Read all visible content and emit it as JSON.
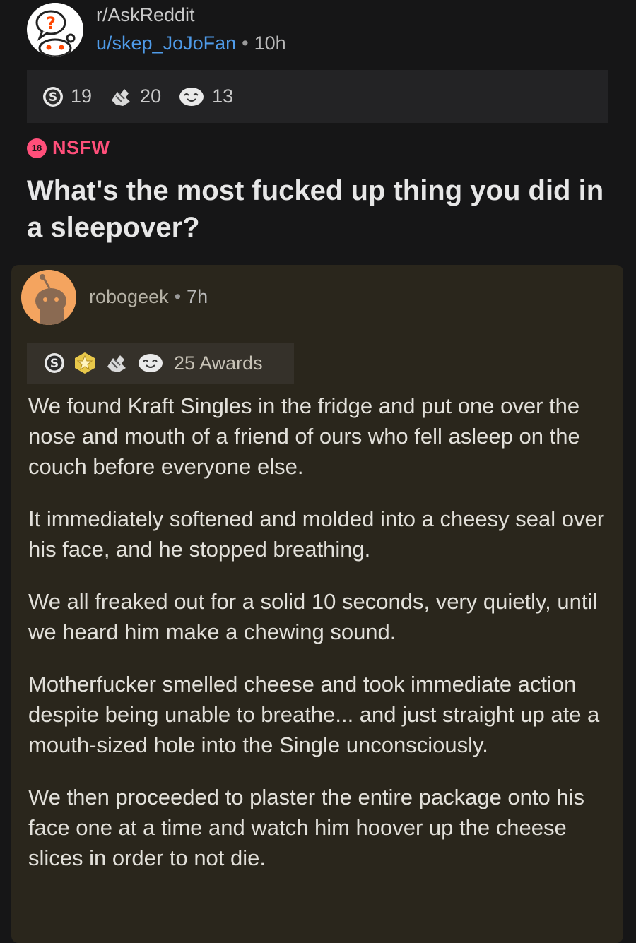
{
  "post": {
    "subreddit": "r/AskReddit",
    "author": "u/skep_JoJoFan",
    "separator": "•",
    "age": "10h",
    "awards": [
      {
        "icon": "silver-award-icon",
        "count": "19"
      },
      {
        "icon": "helpful-award-icon",
        "count": "20"
      },
      {
        "icon": "wholesome-award-icon",
        "count": "13"
      }
    ],
    "nsfw_badge": "18",
    "nsfw_label": "NSFW",
    "title": "What's the most fucked up thing you did in a sleepover?"
  },
  "comment": {
    "username": "robogeek",
    "separator": "•",
    "age": "7h",
    "award_icons": [
      "silver-award-icon",
      "gold-award-icon",
      "helpful-award-icon",
      "wholesome-award-icon"
    ],
    "awards_label": "25 Awards",
    "paragraphs": [
      "We found Kraft Singles in the fridge and put one over the nose and mouth of a friend of ours who fell asleep on the couch before everyone else.",
      "It immediately softened and molded into a cheesy seal over his face, and he stopped breathing.",
      "We all freaked out for a solid 10 seconds, very quietly, until we heard him make a chewing sound.",
      "Motherfucker smelled cheese and took immediate action despite being unable to breathe... and just straight up ate a mouth-sized hole into the Single unconsciously.",
      "We then proceeded to plaster the entire package onto his face one at a time and watch him hoover up the cheese slices in order to not die."
    ]
  },
  "colors": {
    "background": "#161617",
    "link": "#4f9be8",
    "nsfw": "#ff4f7a",
    "comment_bg": "#2a261c"
  }
}
